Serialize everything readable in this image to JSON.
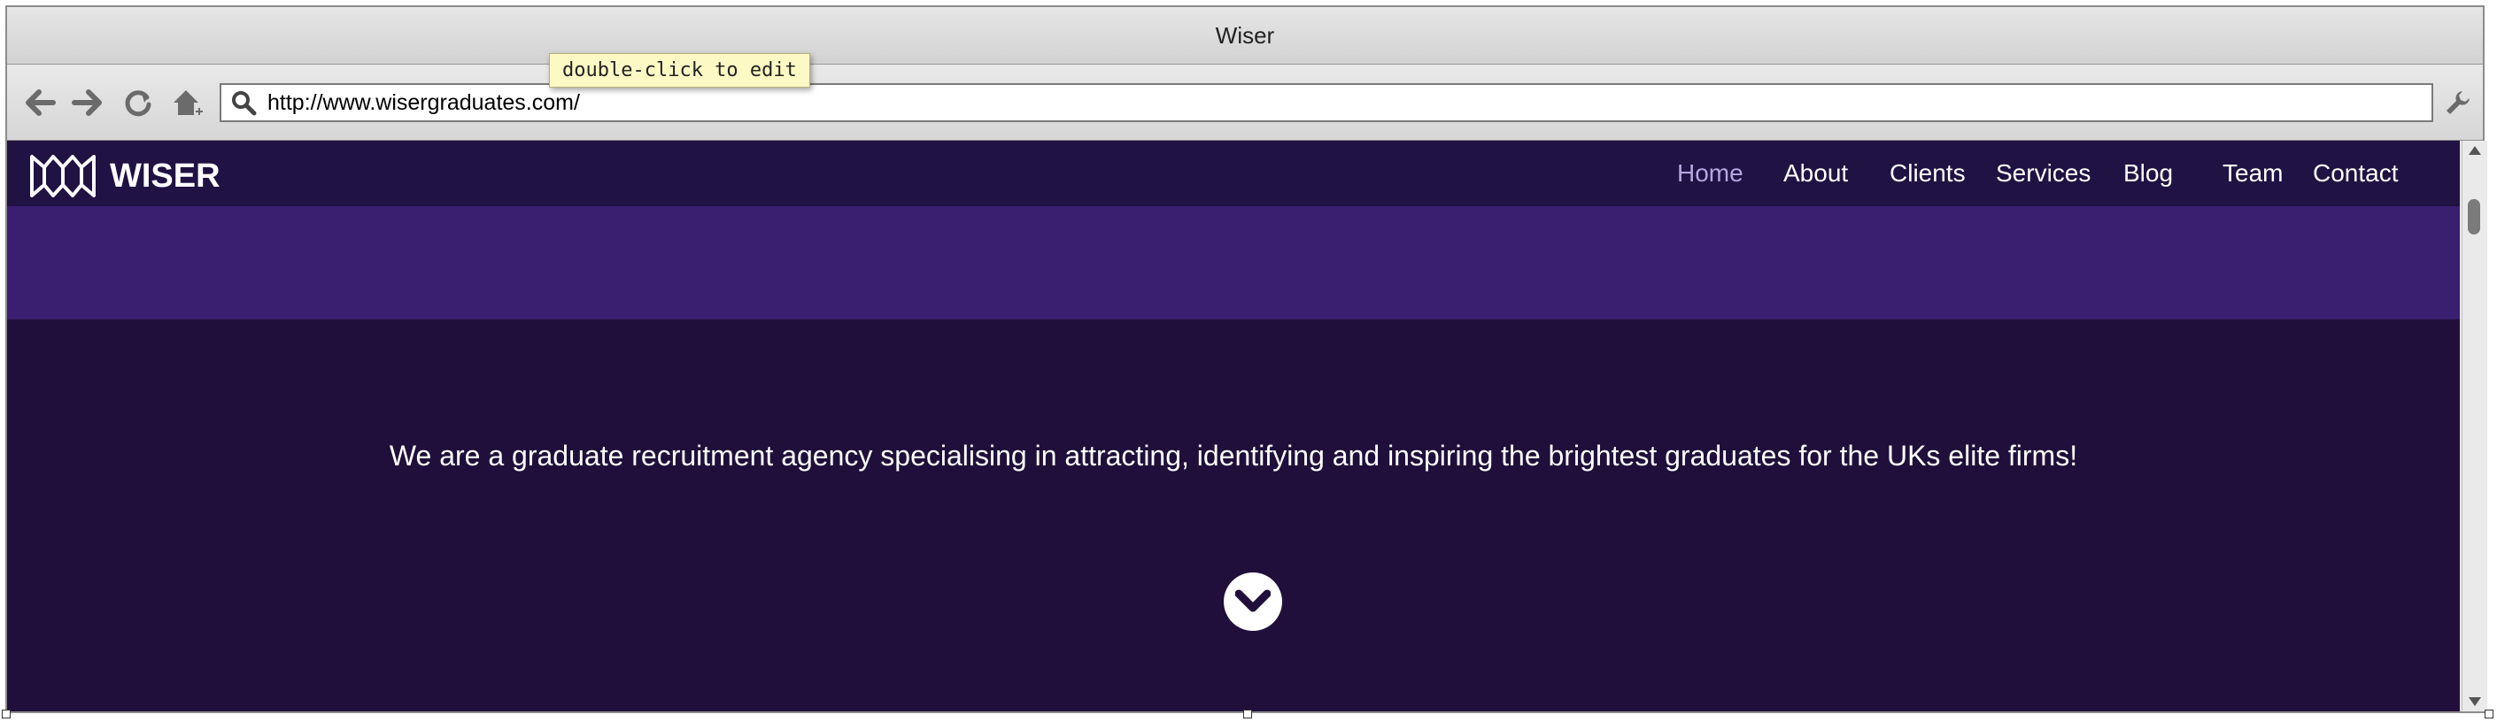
{
  "window": {
    "title": "Wiser"
  },
  "toolbar": {
    "back_icon": "back-arrow-icon",
    "forward_icon": "forward-arrow-icon",
    "reload_icon": "reload-icon",
    "home_icon": "home-icon",
    "search_icon": "search-icon",
    "settings_icon": "wrench-icon",
    "url": "http://www.wisergraduates.com/",
    "tooltip": "double-click to edit"
  },
  "site": {
    "logo_text": "WISER",
    "nav": [
      {
        "label": "Home",
        "active": true
      },
      {
        "label": "About"
      },
      {
        "label": "Clients"
      },
      {
        "label": "Services"
      },
      {
        "label": "Blog"
      },
      {
        "label": "Team"
      },
      {
        "label": "Contact"
      }
    ],
    "tagline": "We are a graduate recruitment agency specialising in attracting, identifying and inspiring the brightest graduates for the UKs elite firms!",
    "scroll_icon": "chevron-down-icon"
  },
  "colors": {
    "navbar": "#201243",
    "band": "#3a1e6f",
    "hero": "#200f3a",
    "active_nav": "#b6a6e0"
  }
}
